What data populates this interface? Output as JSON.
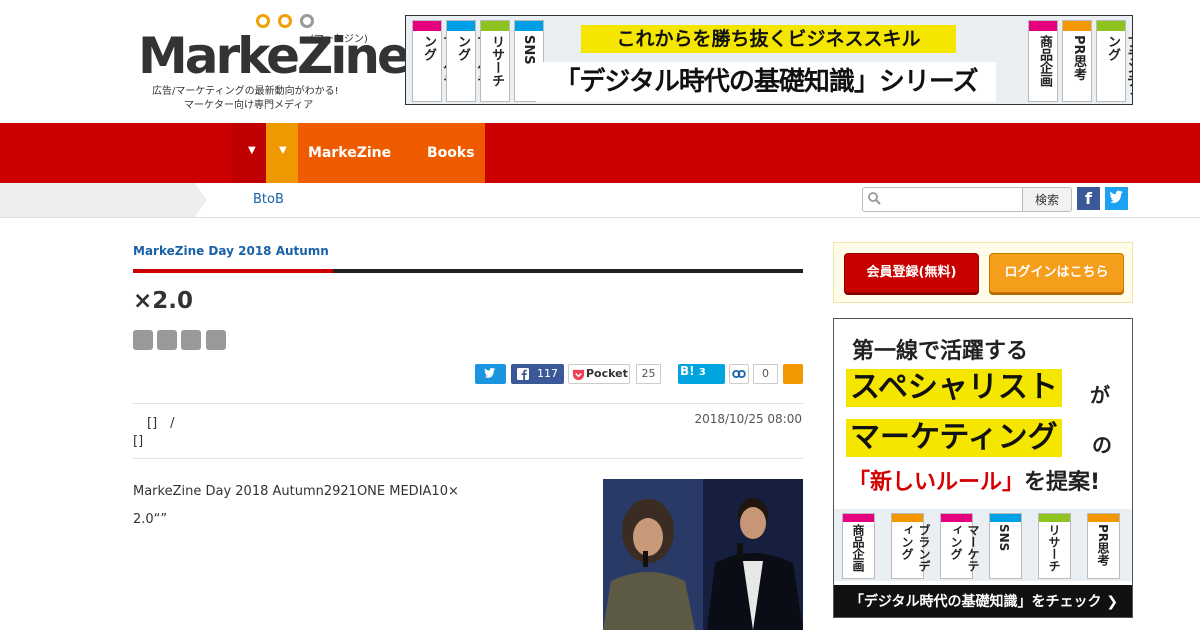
{
  "header": {
    "logo_text": "MarkeZine",
    "logo_kana": "(マーケジン)",
    "tagline_1": "広告/マーケティングの最新動向がわかる!",
    "tagline_2": "マーケター向け専門メディア"
  },
  "banner": {
    "headline": "これからを勝ち抜くビジネススキル",
    "series": "「デジタル時代の基礎知識」シリーズ",
    "books": [
      "マーケティング",
      "リサーチ",
      "SNS",
      "商品企画",
      "PR思考",
      "ブランディング"
    ]
  },
  "nav": {
    "links": [
      "MarkeZine",
      "Books"
    ],
    "arrow": "▼"
  },
  "subnav": {
    "breadcrumb": "BtoB"
  },
  "search": {
    "placeholder": "",
    "button_label": "検索"
  },
  "social": {
    "facebook": "f"
  },
  "article": {
    "event": "MarkeZine Day 2018 Autumn",
    "title": "×2.0",
    "author_line_1": "[]　/",
    "author_line_2": "[]",
    "date": "2018/10/25 08:00",
    "lead_1": "MarkeZine Day 2018 Autumn2921ONE MEDIA10×",
    "lead_2": "2.0“”"
  },
  "share": {
    "facebook_count": "117",
    "pocket_label": "Pocket",
    "pocket_count": "25",
    "hatena_label": "B!",
    "hatena_count": "3",
    "link_count": "0"
  },
  "sidebar": {
    "register_label": "会員登録(無料)",
    "login_label": "ログインはこちら",
    "ad": {
      "line1": "第一線で活躍する",
      "highlight1": "スペシャリスト",
      "particle1": "が",
      "highlight2": "マーケティング",
      "particle2": "の",
      "red_text": "「新しいルール」",
      "line4_tail": "を提案!",
      "books": [
        "商品企画",
        "ブランディング",
        "マーケティング",
        "SNS",
        "リサーチ",
        "PR思考"
      ],
      "footer": "「デジタル時代の基礎知識」をチェック ❯"
    }
  },
  "colors": {
    "nav_red": "#cc0000",
    "nav_orange": "#ef5c00",
    "nav_yellow": "#f09800",
    "link_blue": "#1a62a8",
    "highlight_yellow": "#f5e600"
  }
}
